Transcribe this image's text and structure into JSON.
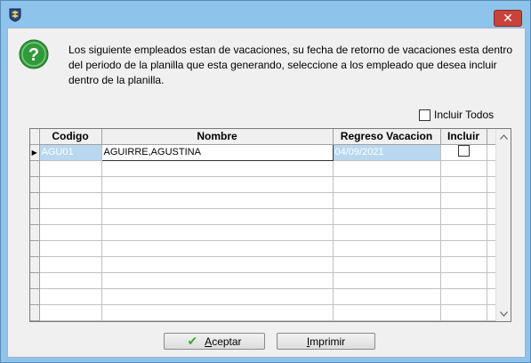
{
  "window": {
    "close_glyph": "✕"
  },
  "message": {
    "icon": "question-mark-icon",
    "glyph": "?",
    "text": "Los siguiente empleados estan de vacaciones, su fecha de retorno de vacaciones esta dentro del periodo de la planilla que esta generando, seleccione a los empleado que desea incluir dentro de la planilla."
  },
  "incluir_todos": {
    "label": "Incluir Todos",
    "checked": false
  },
  "grid": {
    "columns": [
      "Codigo",
      "Nombre",
      "Regreso Vacacion",
      "Incluir"
    ],
    "rows": [
      {
        "codigo": "AGU01",
        "nombre": "AGUIRRE,AGUSTINA",
        "regreso": "04/09/2021",
        "incluir": false
      }
    ],
    "current_row_marker": "▶"
  },
  "buttons": {
    "aceptar_accel": "A",
    "aceptar_rest": "ceptar",
    "imprimir_accel": "I",
    "imprimir_rest": "mprimir"
  },
  "colors": {
    "title_bg": "#8ec4ec",
    "close_bg": "#c8433a",
    "help_icon": "#2f9a3a",
    "selected_row": "#b9d8f0"
  }
}
